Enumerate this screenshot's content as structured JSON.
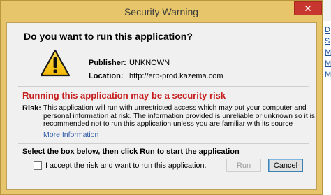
{
  "window": {
    "title": "Security Warning",
    "close_glyph": "✕"
  },
  "dialog": {
    "question": "Do you want to run this application?",
    "icon": "warning-triangle-icon",
    "publisher_label": "Publisher:",
    "publisher_value": "UNKNOWN",
    "location_label": "Location:",
    "location_value": "http://erp-prod.kazema.com",
    "risk_heading": "Running this application may be a security risk",
    "risk_label": "Risk:",
    "risk_text": "This application will run with unrestricted access which may put your computer and personal information at risk. The information provided is unreliable or unknown so it is recommended not to run this application unless you are familiar with its source",
    "more_info": "More Information",
    "instruction": "Select the box below, then click Run to start the application",
    "accept_label": "I accept the risk and want to run this application.",
    "accept_checked": false,
    "run_label": "Run",
    "run_enabled": false,
    "cancel_label": "Cancel"
  },
  "background": {
    "side_letters": [
      "D",
      "S",
      "M",
      "M",
      "M"
    ]
  },
  "colors": {
    "title_bar": "#e7c66b",
    "close_button": "#c7372f",
    "risk_heading": "#c61d1d",
    "link": "#2d5aa6"
  }
}
